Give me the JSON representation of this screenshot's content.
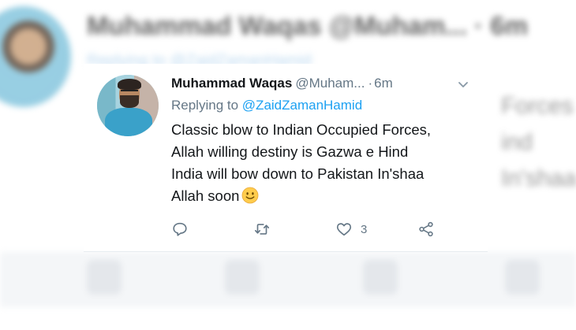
{
  "background": {
    "blurred_name": "Muhammad Waqas @Muham... · 6m",
    "blurred_reply": "Replying to @ZaidZamanHamid",
    "blurred_side_lines": [
      "Forces",
      "ind",
      "In'shaa"
    ]
  },
  "tweet": {
    "author_name": "Muhammad Waqas",
    "author_handle": "@Muham...",
    "separator": "·",
    "time": "6m",
    "replying_prefix": "Replying to",
    "replying_to": "@ZaidZamanHamid",
    "lines": [
      "Classic blow to Indian Occupied Forces,",
      "Allah willing destiny is Gazwa e Hind",
      "India will bow down to Pakistan In'shaa",
      "Allah soon"
    ],
    "emoji": "slightly-smiling-face-icon",
    "like_count": "3"
  },
  "icons": {
    "menu": "chevron-down-icon",
    "reply": "reply-icon",
    "retweet": "retweet-icon",
    "like": "heart-icon",
    "share": "share-icon"
  },
  "colors": {
    "link": "#1da1f2",
    "secondary_text": "#657786",
    "primary_text": "#14171a",
    "emoji_yellow": "#ffcc4d"
  }
}
